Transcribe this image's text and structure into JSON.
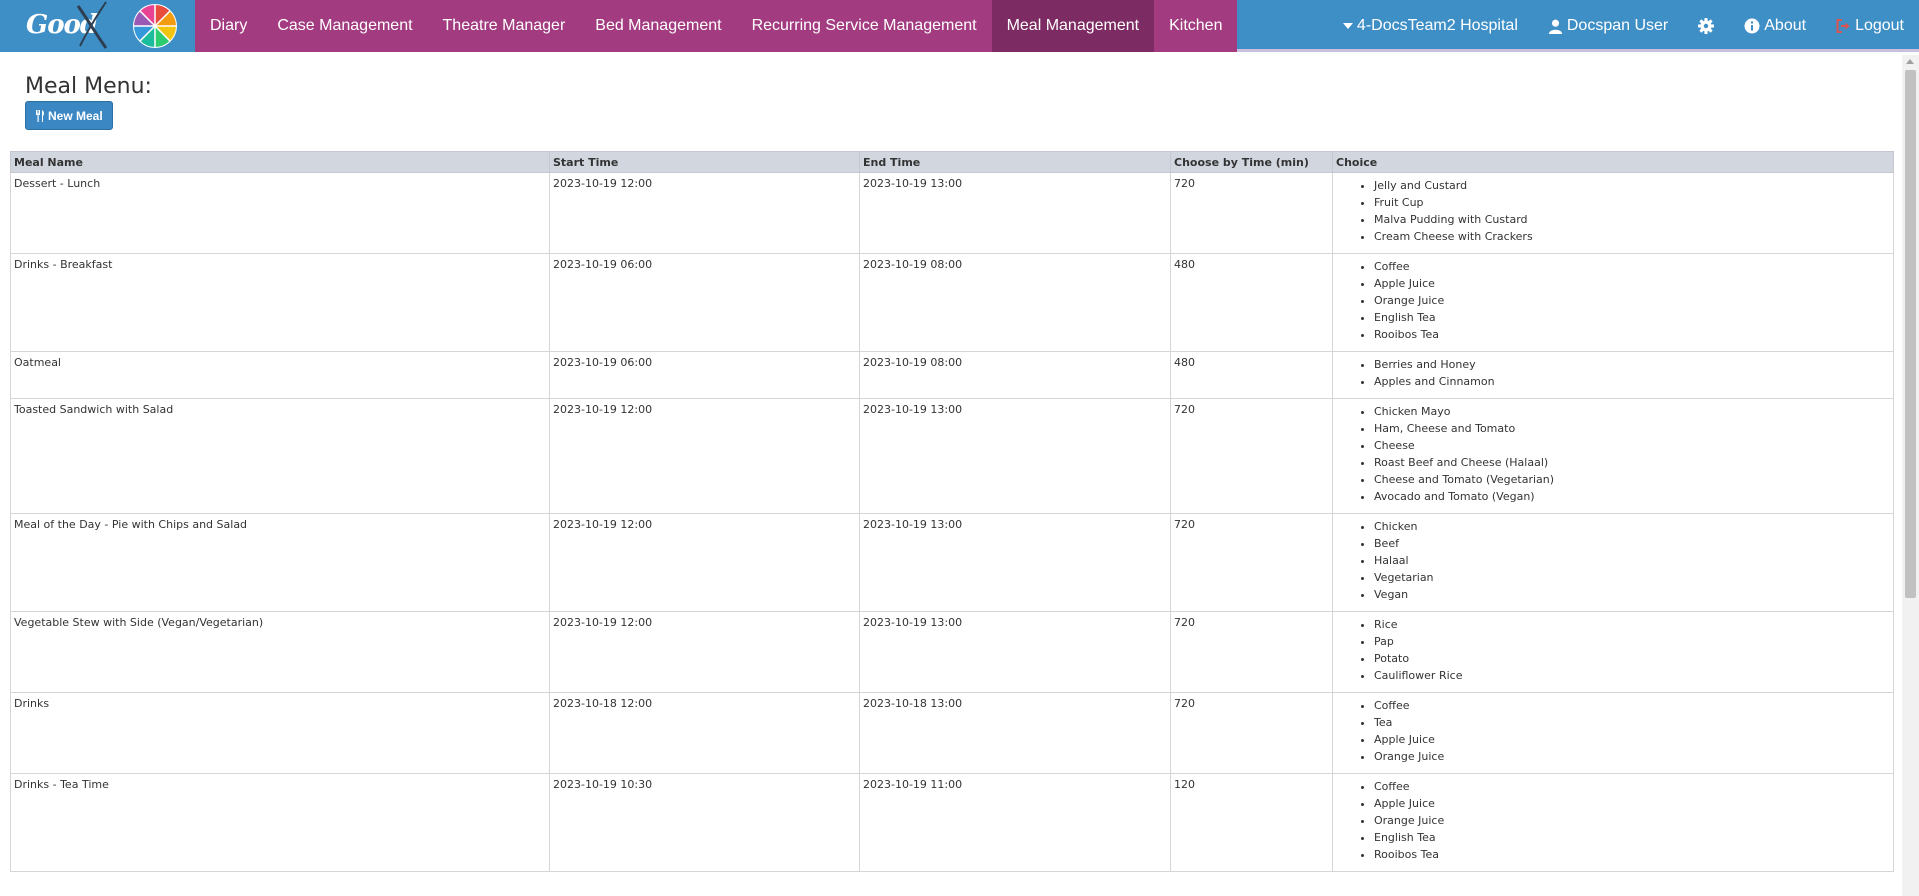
{
  "brand": {
    "logo_text": "Good"
  },
  "nav": {
    "items": [
      {
        "label": "Diary",
        "active": false
      },
      {
        "label": "Case Management",
        "active": false
      },
      {
        "label": "Theatre Manager",
        "active": false
      },
      {
        "label": "Bed Management",
        "active": false
      },
      {
        "label": "Recurring Service Management",
        "active": false
      },
      {
        "label": "Meal Management",
        "active": true
      },
      {
        "label": "Kitchen",
        "active": false
      }
    ],
    "hospital": "4-DocsTeam2 Hospital",
    "user": "Docspan User",
    "about": "About",
    "logout": "Logout"
  },
  "colors": {
    "nav_blue": "#3f8fc7",
    "nav_purple": "#a33b80",
    "nav_active": "#7d2b63",
    "button_blue": "#3a87c4",
    "logout_icon": "#d9534f"
  },
  "page": {
    "title": "Meal Menu:",
    "new_meal_label": "New Meal"
  },
  "table": {
    "columns": [
      "Meal Name",
      "Start Time",
      "End Time",
      "Choose by Time (min)",
      "Choice"
    ],
    "rows": [
      {
        "name": "Dessert - Lunch",
        "start": "2023-10-19 12:00",
        "end": "2023-10-19 13:00",
        "choose_by": "720",
        "choices": [
          "Jelly and Custard",
          "Fruit Cup",
          "Malva Pudding with Custard",
          "Cream Cheese with Crackers"
        ]
      },
      {
        "name": "Drinks - Breakfast",
        "start": "2023-10-19 06:00",
        "end": "2023-10-19 08:00",
        "choose_by": "480",
        "choices": [
          "Coffee",
          "Apple Juice",
          "Orange Juice",
          "English Tea",
          "Rooibos Tea"
        ]
      },
      {
        "name": "Oatmeal",
        "start": "2023-10-19 06:00",
        "end": "2023-10-19 08:00",
        "choose_by": "480",
        "choices": [
          "Berries and Honey",
          "Apples and Cinnamon"
        ]
      },
      {
        "name": "Toasted Sandwich with Salad",
        "start": "2023-10-19 12:00",
        "end": "2023-10-19 13:00",
        "choose_by": "720",
        "choices": [
          "Chicken Mayo",
          "Ham, Cheese and Tomato",
          "Cheese",
          "Roast Beef and Cheese (Halaal)",
          "Cheese and Tomato (Vegetarian)",
          "Avocado and Tomato (Vegan)"
        ]
      },
      {
        "name": "Meal of the Day - Pie with Chips and Salad",
        "start": "2023-10-19 12:00",
        "end": "2023-10-19 13:00",
        "choose_by": "720",
        "choices": [
          "Chicken",
          "Beef",
          "Halaal",
          "Vegetarian",
          "Vegan"
        ]
      },
      {
        "name": "Vegetable Stew with Side (Vegan/Vegetarian)",
        "start": "2023-10-19 12:00",
        "end": "2023-10-19 13:00",
        "choose_by": "720",
        "choices": [
          "Rice",
          "Pap",
          "Potato",
          "Cauliflower Rice"
        ]
      },
      {
        "name": "Drinks",
        "start": "2023-10-18 12:00",
        "end": "2023-10-18 13:00",
        "choose_by": "720",
        "choices": [
          "Coffee",
          "Tea",
          "Apple Juice",
          "Orange Juice"
        ]
      },
      {
        "name": "Drinks - Tea Time",
        "start": "2023-10-19 10:30",
        "end": "2023-10-19 11:00",
        "choose_by": "120",
        "choices": [
          "Coffee",
          "Apple Juice",
          "Orange Juice",
          "English Tea",
          "Rooibos Tea"
        ]
      }
    ]
  }
}
